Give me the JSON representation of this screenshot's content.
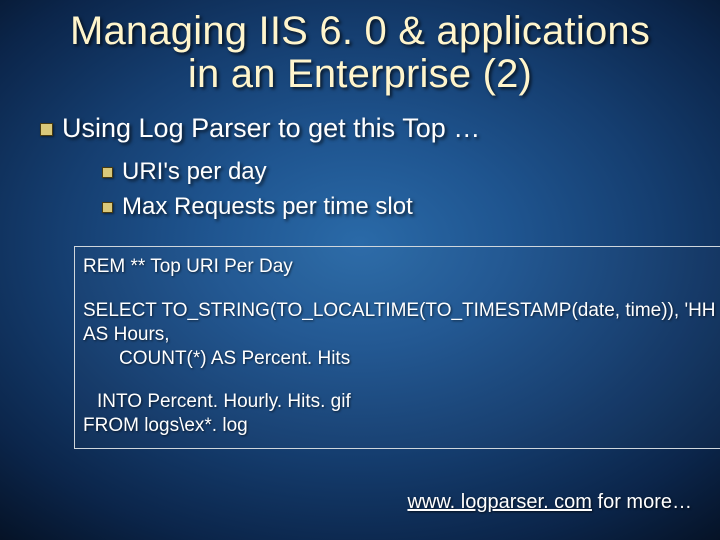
{
  "title_line1": "Managing IIS 6. 0 & applications",
  "title_line2": "in an Enterprise (2)",
  "bullets": {
    "lvl1_0": "Using Log Parser to get this Top …",
    "lvl2_0": "URI's per day",
    "lvl2_1": "Max Requests per time slot"
  },
  "code": {
    "l0": "REM ** Top URI Per Day",
    "l1": "SELECT TO_STRING(TO_LOCALTIME(TO_TIMESTAMP(date, time)), 'HH",
    "l2": "AS Hours,",
    "l3": "COUNT(*) AS Percent. Hits",
    "l4": "INTO Percent. Hourly. Hits. gif",
    "l5": "FROM logs\\ex*. log"
  },
  "footnote": {
    "link_text": "www. logparser. com",
    "rest": " for more…"
  }
}
